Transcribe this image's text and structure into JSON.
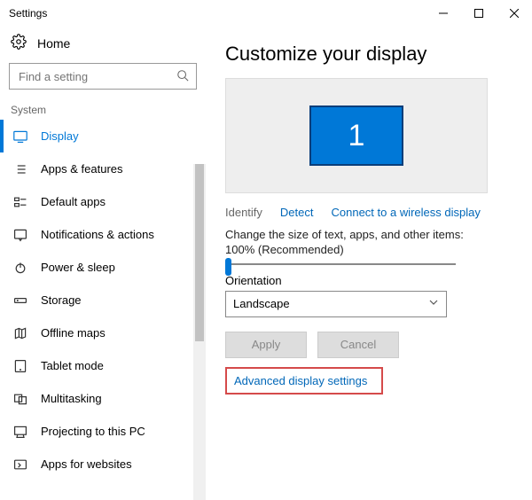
{
  "window": {
    "title": "Settings"
  },
  "home": {
    "label": "Home"
  },
  "search": {
    "placeholder": "Find a setting"
  },
  "group": {
    "label": "System"
  },
  "nav": [
    {
      "label": "Display",
      "selected": true
    },
    {
      "label": "Apps & features"
    },
    {
      "label": "Default apps"
    },
    {
      "label": "Notifications & actions"
    },
    {
      "label": "Power & sleep"
    },
    {
      "label": "Storage"
    },
    {
      "label": "Offline maps"
    },
    {
      "label": "Tablet mode"
    },
    {
      "label": "Multitasking"
    },
    {
      "label": "Projecting to this PC"
    },
    {
      "label": "Apps for websites"
    }
  ],
  "main": {
    "heading": "Customize your display",
    "monitor_number": "1",
    "identify": "Identify",
    "detect": "Detect",
    "connect": "Connect to a wireless display",
    "scale_text": "Change the size of text, apps, and other items: 100% (Recommended)",
    "orientation_label": "Orientation",
    "orientation_value": "Landscape",
    "apply": "Apply",
    "cancel": "Cancel",
    "advanced": "Advanced display settings"
  }
}
